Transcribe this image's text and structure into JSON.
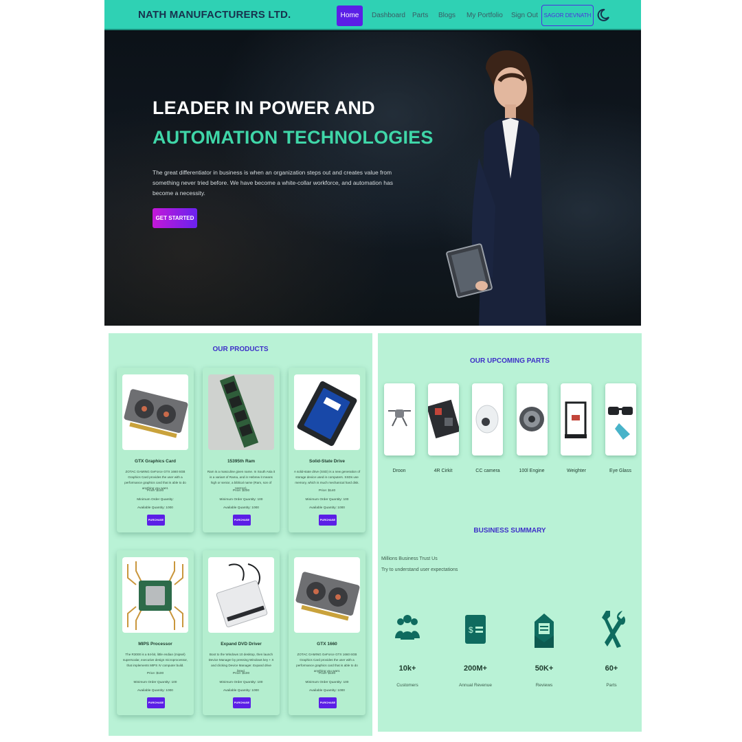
{
  "navbar": {
    "brand": "NATH MANUFACTURERS LTD.",
    "items": [
      "Home",
      "Dashboard",
      "Parts",
      "Blogs",
      "My Portfolio",
      "Sign Out"
    ],
    "user_button": "SAGOR DEVNATH",
    "theme_icon": "moon-icon"
  },
  "hero": {
    "title_line1": "LEADER IN POWER AND",
    "title_line2": "AUTOMATION TECHNOLOGIES",
    "description": "The great differentiator in business is when an organization steps out and creates value from something never tried before. We have become a white-collar workforce, and automation has become a necessity.",
    "cta": "GET STARTED"
  },
  "products": {
    "title": "OUR PRODUCTS",
    "items": [
      {
        "name": "GTX Graphics Card",
        "description": "ZOTAC GAMING GeForce GTX 1660 6GB Graphics Card provides the user with a performance graphics card that is able to do anything you want.",
        "price": "Price: $100",
        "min_order": "Minimum Order Quantity:",
        "available": "Available Quantity: 1000",
        "button": "PURCHASE",
        "icon": "graphics-card-image"
      },
      {
        "name": "15395th Ram",
        "description": "Ram is a masculine given name. In South Asia it is a variant of Rama, and in Hebrew it means high or senior, a biblical name (Ram, son of Hezron).",
        "price": "Price: $100",
        "min_order": "Minimum Order Quantity: 100",
        "available": "Available Quantity: 1000",
        "button": "PURCHASE",
        "icon": "ram-module-image"
      },
      {
        "name": "Solid-State Drive",
        "description": "A solid-state drive (SSD) is a new generation of storage device used in computers. SSDs use memory, which is much mechanical hard disk.",
        "price": "Price: $140",
        "min_order": "Minimum Order Quantity: 100",
        "available": "Available Quantity: 1000",
        "button": "PURCHASE",
        "icon": "ssd-image"
      },
      {
        "name": "MIPS Processor",
        "description": "The R3000 is a 64-bit, little endian (mipsel) superscalar, executive design microprocessor, that implements MIPS IV computer build.",
        "price": "Price: $100",
        "min_order": "Minimum Order Quantity: 100",
        "available": "Available Quantity: 1000",
        "button": "PURCHASE",
        "icon": "processor-chip-image"
      },
      {
        "name": "Expand DVD Driver",
        "description": "Boot to the Windows 10 desktop, then launch Device Manager by pressing Windows key + X and clicking Device Manager. Expand drive listed.",
        "price": "Price: $100",
        "min_order": "Minimum Order Quantity: 100",
        "available": "Available Quantity: 1000",
        "button": "PURCHASE",
        "icon": "dvd-drive-image"
      },
      {
        "name": "GTX 1660",
        "description": "ZOTAC GAMING GeForce GTX 1660 6GB Graphics Card provides the user with a performance graphics card that is able to do anything you want.",
        "price": "Price: $100",
        "min_order": "Minimum Order Quantity: 100",
        "available": "Available Quantity: 1000",
        "button": "PURCHASE",
        "icon": "graphics-card-image"
      }
    ]
  },
  "upcoming": {
    "title": "OUR UPCOMING PARTS",
    "items": [
      {
        "label": "Droon",
        "icon": "drone-image"
      },
      {
        "label": "4R Cirkit",
        "icon": "circuit-board-image"
      },
      {
        "label": "CC camera",
        "icon": "cctv-camera-image"
      },
      {
        "label": "100l Engine",
        "icon": "engine-image"
      },
      {
        "label": "Weighter",
        "icon": "3d-printer-image"
      },
      {
        "label": "Eye Glass",
        "icon": "3d-glasses-image"
      }
    ]
  },
  "summary": {
    "title": "BUSINESS SUMMARY",
    "line1": "Millions Business Trust Us",
    "line2": "Try to understand user expectations",
    "stats": [
      {
        "value": "10k+",
        "label": "Customers",
        "icon": "users-icon"
      },
      {
        "value": "200M+",
        "label": "Annual Revenue",
        "icon": "money-icon"
      },
      {
        "value": "50K+",
        "label": "Reviews",
        "icon": "review-icon"
      },
      {
        "value": "60+",
        "label": "Parts",
        "icon": "tools-icon"
      }
    ]
  },
  "colors": {
    "navbar_bg": "#2fd1b4",
    "accent_purple": "#5b1fe6",
    "hero_green_text": "#3fd6a8",
    "panel_bg": "#b9f2d6",
    "section_title": "#3d2fc8",
    "stat_icon": "#0f6b5f"
  }
}
